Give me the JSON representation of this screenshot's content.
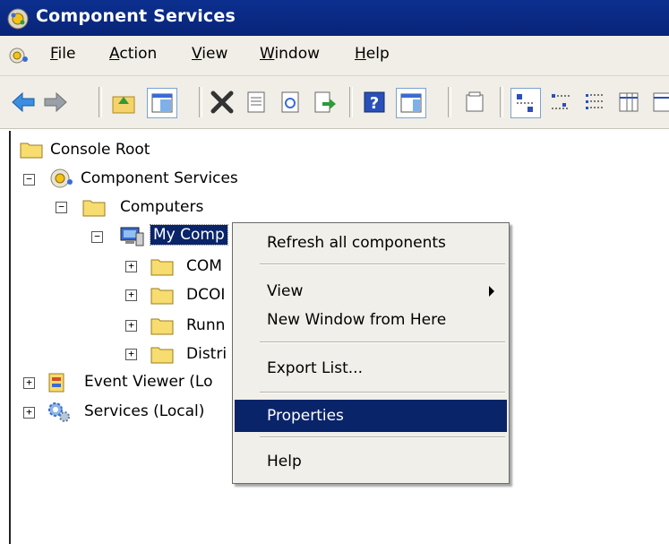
{
  "window": {
    "title": "Component Services"
  },
  "menubar": {
    "items": [
      {
        "label_u": "F",
        "label_rest": "ile"
      },
      {
        "label_u": "A",
        "label_rest": "ction"
      },
      {
        "label_u": "V",
        "label_rest": "iew"
      },
      {
        "label_u": "W",
        "label_rest": "indow"
      },
      {
        "label_u": "H",
        "label_rest": "elp"
      }
    ]
  },
  "toolbar": {
    "icons": [
      "back-arrow-icon",
      "forward-arrow-icon",
      "up-folder-icon",
      "show-hide-tree-icon",
      "delete-icon",
      "properties-icon",
      "refresh-icon",
      "export-list-icon",
      "help-icon",
      "show-hide-action-pane-icon",
      "new-window-icon",
      "large-icons-view-icon",
      "small-icons-view-icon",
      "list-view-icon",
      "detail-view-icon"
    ]
  },
  "tree": {
    "console_root": "Console Root",
    "component_services": "Component Services",
    "computers": "Computers",
    "my_computer": "My Comp",
    "com": "COM",
    "dcom": "DCOI",
    "running": "Runn",
    "distributed": "Distri",
    "event_viewer": "Event Viewer (Lo",
    "services": "Services (Local)"
  },
  "context_menu": {
    "refresh": "Refresh all components",
    "view": "View",
    "new_window": "New Window from Here",
    "export_list": "Export List...",
    "properties": "Properties",
    "help": "Help"
  },
  "colors": {
    "titlebar": "#0c2f8f",
    "selection": "#0a246a",
    "menu_bg": "#f1efe9"
  }
}
